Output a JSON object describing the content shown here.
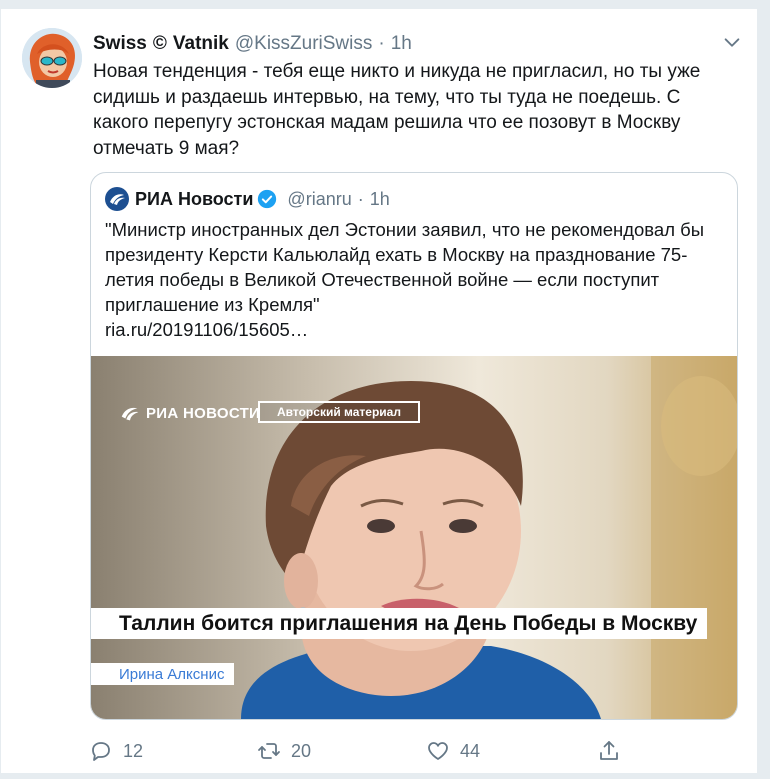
{
  "tweet": {
    "display_name": "Swiss",
    "copyright_mark": "©",
    "display_name_2": "Vatnik",
    "handle": "@KissZuriSwiss",
    "separator": "·",
    "time": "1h",
    "text": "Новая тенденция - тебя еще никто и никуда не пригласил, но ты уже сидишь и раздаешь интервью, на тему, что ты туда не поедешь. С какого перепугу эстонская мадам решила что ее позовут в Москву отмечать 9 мая?"
  },
  "quoted": {
    "display_name": "РИА Новости",
    "handle": "@rianru",
    "separator": "·",
    "time": "1h",
    "text": "\"Министр иностранных дел Эстонии заявил, что не рекомендовал бы президенту Керсти Кальюлайд ехать в Москву на празднование 75-летия победы в Великой Отечественной войне — если поступит приглашение из Кремля\"",
    "link": "ria.ru/20191106/15605…",
    "image": {
      "watermark": "РИА НОВОСТИ",
      "badge": "Авторский материал",
      "headline": "Таллин боится приглашения на День Победы в Москву",
      "author": "Ирина Алкснис"
    }
  },
  "actions": {
    "reply_count": "12",
    "retweet_count": "20",
    "like_count": "44"
  },
  "icons": {
    "verified": "verified-badge-icon",
    "reply": "reply-icon",
    "retweet": "retweet-icon",
    "like": "heart-icon",
    "share": "share-icon",
    "menu": "chevron-down-icon"
  },
  "colors": {
    "accent": "#1da1f2",
    "muted": "#657786",
    "author_link": "#3a7bd5"
  }
}
